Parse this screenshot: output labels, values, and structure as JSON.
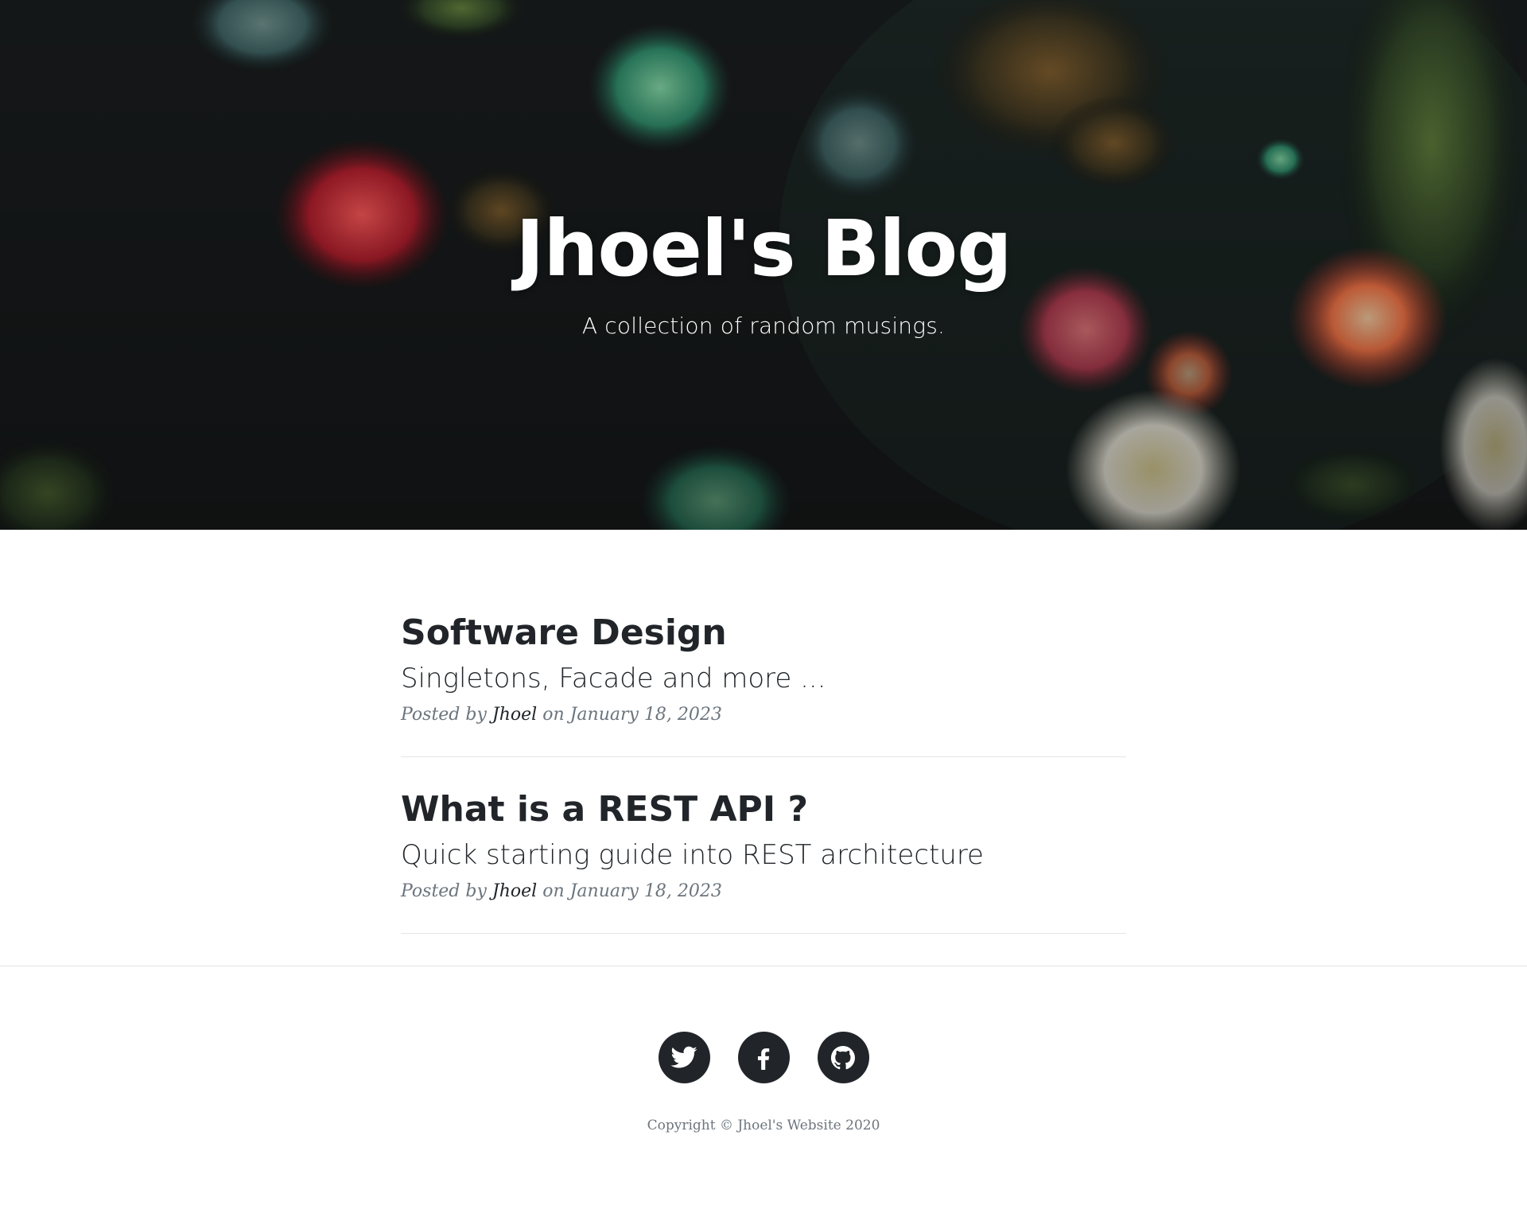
{
  "header": {
    "title": "Jhoel's Blog",
    "subtitle": "A collection of random musings."
  },
  "posts": [
    {
      "title": "Software Design",
      "subtitle": "Singletons, Facade and more ...",
      "meta_prefix": "Posted by",
      "author": "Jhoel",
      "meta_suffix": "on January 18, 2023"
    },
    {
      "title": "What is a REST API ?",
      "subtitle": "Quick starting guide into REST architecture",
      "meta_prefix": "Posted by",
      "author": "Jhoel",
      "meta_suffix": "on January 18, 2023"
    }
  ],
  "footer": {
    "social_icons": [
      "twitter-icon",
      "facebook-icon",
      "github-icon"
    ],
    "copyright": "Copyright © Jhoel's Website 2020"
  },
  "colors": {
    "text": "#212529",
    "muted": "#6c757d",
    "hero_bg": "#15191a"
  }
}
